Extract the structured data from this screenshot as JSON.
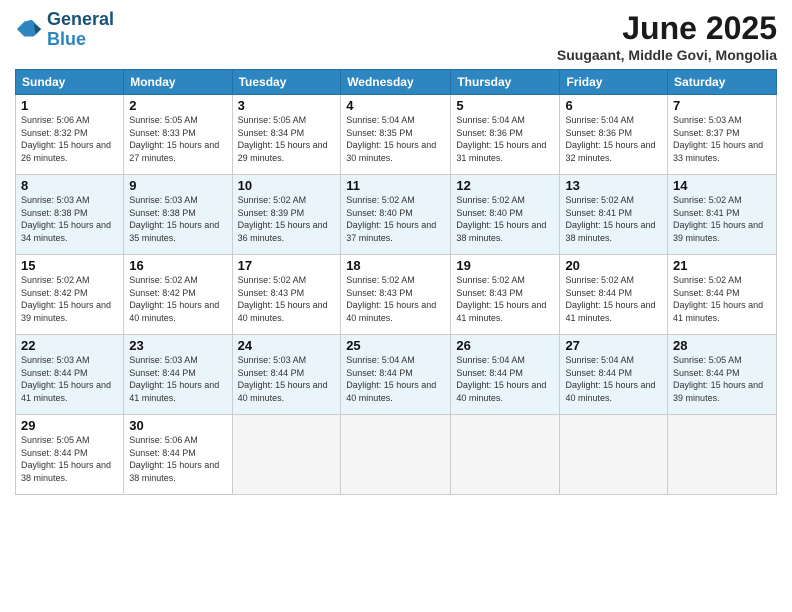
{
  "logo": {
    "line1": "General",
    "line2": "Blue"
  },
  "title": "June 2025",
  "subtitle": "Suugaant, Middle Govi, Mongolia",
  "days": [
    "Sunday",
    "Monday",
    "Tuesday",
    "Wednesday",
    "Thursday",
    "Friday",
    "Saturday"
  ],
  "weeks": [
    [
      {
        "num": "1",
        "rise": "5:06 AM",
        "set": "8:32 PM",
        "daylight": "15 hours and 26 minutes."
      },
      {
        "num": "2",
        "rise": "5:05 AM",
        "set": "8:33 PM",
        "daylight": "15 hours and 27 minutes."
      },
      {
        "num": "3",
        "rise": "5:05 AM",
        "set": "8:34 PM",
        "daylight": "15 hours and 29 minutes."
      },
      {
        "num": "4",
        "rise": "5:04 AM",
        "set": "8:35 PM",
        "daylight": "15 hours and 30 minutes."
      },
      {
        "num": "5",
        "rise": "5:04 AM",
        "set": "8:36 PM",
        "daylight": "15 hours and 31 minutes."
      },
      {
        "num": "6",
        "rise": "5:04 AM",
        "set": "8:36 PM",
        "daylight": "15 hours and 32 minutes."
      },
      {
        "num": "7",
        "rise": "5:03 AM",
        "set": "8:37 PM",
        "daylight": "15 hours and 33 minutes."
      }
    ],
    [
      {
        "num": "8",
        "rise": "5:03 AM",
        "set": "8:38 PM",
        "daylight": "15 hours and 34 minutes."
      },
      {
        "num": "9",
        "rise": "5:03 AM",
        "set": "8:38 PM",
        "daylight": "15 hours and 35 minutes."
      },
      {
        "num": "10",
        "rise": "5:02 AM",
        "set": "8:39 PM",
        "daylight": "15 hours and 36 minutes."
      },
      {
        "num": "11",
        "rise": "5:02 AM",
        "set": "8:40 PM",
        "daylight": "15 hours and 37 minutes."
      },
      {
        "num": "12",
        "rise": "5:02 AM",
        "set": "8:40 PM",
        "daylight": "15 hours and 38 minutes."
      },
      {
        "num": "13",
        "rise": "5:02 AM",
        "set": "8:41 PM",
        "daylight": "15 hours and 38 minutes."
      },
      {
        "num": "14",
        "rise": "5:02 AM",
        "set": "8:41 PM",
        "daylight": "15 hours and 39 minutes."
      }
    ],
    [
      {
        "num": "15",
        "rise": "5:02 AM",
        "set": "8:42 PM",
        "daylight": "15 hours and 39 minutes."
      },
      {
        "num": "16",
        "rise": "5:02 AM",
        "set": "8:42 PM",
        "daylight": "15 hours and 40 minutes."
      },
      {
        "num": "17",
        "rise": "5:02 AM",
        "set": "8:43 PM",
        "daylight": "15 hours and 40 minutes."
      },
      {
        "num": "18",
        "rise": "5:02 AM",
        "set": "8:43 PM",
        "daylight": "15 hours and 40 minutes."
      },
      {
        "num": "19",
        "rise": "5:02 AM",
        "set": "8:43 PM",
        "daylight": "15 hours and 41 minutes."
      },
      {
        "num": "20",
        "rise": "5:02 AM",
        "set": "8:44 PM",
        "daylight": "15 hours and 41 minutes."
      },
      {
        "num": "21",
        "rise": "5:02 AM",
        "set": "8:44 PM",
        "daylight": "15 hours and 41 minutes."
      }
    ],
    [
      {
        "num": "22",
        "rise": "5:03 AM",
        "set": "8:44 PM",
        "daylight": "15 hours and 41 minutes."
      },
      {
        "num": "23",
        "rise": "5:03 AM",
        "set": "8:44 PM",
        "daylight": "15 hours and 41 minutes."
      },
      {
        "num": "24",
        "rise": "5:03 AM",
        "set": "8:44 PM",
        "daylight": "15 hours and 40 minutes."
      },
      {
        "num": "25",
        "rise": "5:04 AM",
        "set": "8:44 PM",
        "daylight": "15 hours and 40 minutes."
      },
      {
        "num": "26",
        "rise": "5:04 AM",
        "set": "8:44 PM",
        "daylight": "15 hours and 40 minutes."
      },
      {
        "num": "27",
        "rise": "5:04 AM",
        "set": "8:44 PM",
        "daylight": "15 hours and 40 minutes."
      },
      {
        "num": "28",
        "rise": "5:05 AM",
        "set": "8:44 PM",
        "daylight": "15 hours and 39 minutes."
      }
    ],
    [
      {
        "num": "29",
        "rise": "5:05 AM",
        "set": "8:44 PM",
        "daylight": "15 hours and 38 minutes."
      },
      {
        "num": "30",
        "rise": "5:06 AM",
        "set": "8:44 PM",
        "daylight": "15 hours and 38 minutes."
      },
      null,
      null,
      null,
      null,
      null
    ]
  ]
}
